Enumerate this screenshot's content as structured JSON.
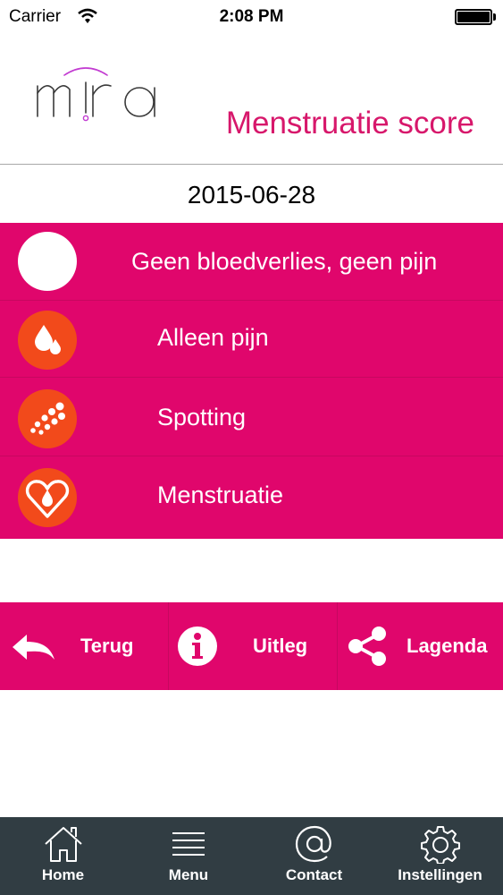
{
  "status_bar": {
    "carrier": "Carrier",
    "time": "2:08 PM"
  },
  "header": {
    "logo_text": "mira",
    "title": "Menstruatie score"
  },
  "date": "2015-06-28",
  "score_options": [
    {
      "label": "Geen bloedverlies, geen pijn",
      "icon": "white-circle-icon"
    },
    {
      "label": "Alleen pijn",
      "icon": "drops-icon"
    },
    {
      "label": "Spotting",
      "icon": "spotting-dots-icon"
    },
    {
      "label": "Menstruatie",
      "icon": "heart-drop-icon"
    }
  ],
  "actions": {
    "back_label": "Terug",
    "info_label": "Uitleg",
    "legend_label": "Lagenda"
  },
  "tabs": [
    {
      "label": "Home",
      "icon": "home-icon"
    },
    {
      "label": "Menu",
      "icon": "menu-icon"
    },
    {
      "label": "Contact",
      "icon": "at-icon"
    },
    {
      "label": "Instellingen",
      "icon": "gear-icon"
    }
  ],
  "colors": {
    "accent": "#e0066c",
    "title": "#d7176b",
    "icon_orange": "#f24a1b",
    "tab_bar": "#313d43"
  }
}
